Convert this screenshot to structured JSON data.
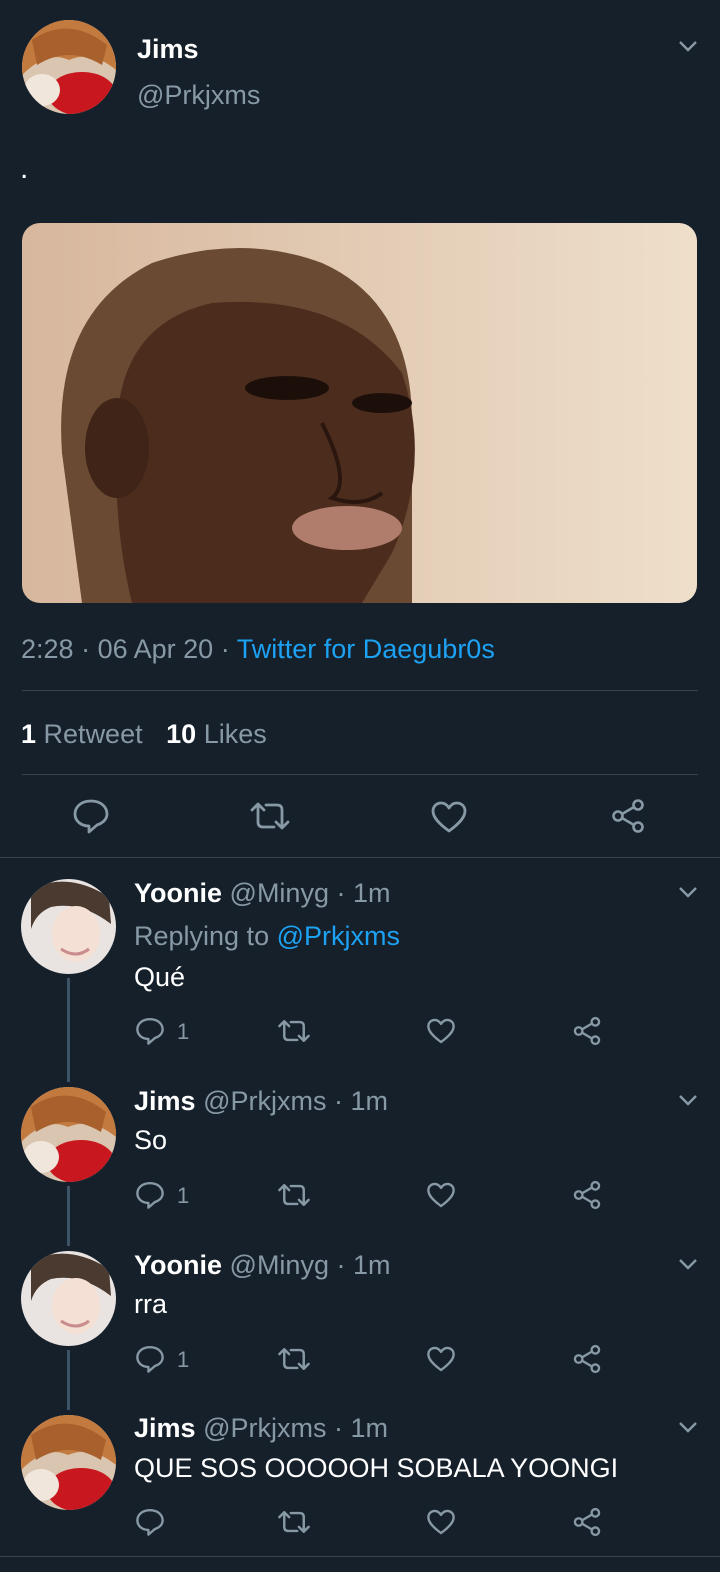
{
  "main_tweet": {
    "display_name": "Jims",
    "handle": "@Prkjxms",
    "text": ".",
    "time": "2:28",
    "date": "06 Apr 20",
    "source": "Twitter for Daegubr0s",
    "retweets_count": "1",
    "retweets_label": "Retweet",
    "likes_count": "10",
    "likes_label": "Likes",
    "separator": "·"
  },
  "replies": [
    {
      "display_name": "Yoonie",
      "handle": "@Minyg",
      "time": "1m",
      "replying_label": "Replying to",
      "replying_to": "@Prkjxms",
      "text": "Qué",
      "reply_count": "1"
    },
    {
      "display_name": "Jims",
      "handle": "@Prkjxms",
      "time": "1m",
      "text": "So",
      "reply_count": "1"
    },
    {
      "display_name": "Yoonie",
      "handle": "@Minyg",
      "time": "1m",
      "text": "rra",
      "reply_count": "1"
    },
    {
      "display_name": "Jims",
      "handle": "@Prkjxms",
      "time": "1m",
      "text": "QUE SOS OOOOOH SOBALA YOONGI",
      "reply_count": ""
    }
  ],
  "icons": [
    "chevron-down-icon",
    "reply-icon",
    "retweet-icon",
    "like-icon",
    "share-icon"
  ],
  "colors": {
    "background": "#15202b",
    "muted": "#8899a6",
    "link": "#1da1f2",
    "divider": "#38444d"
  }
}
